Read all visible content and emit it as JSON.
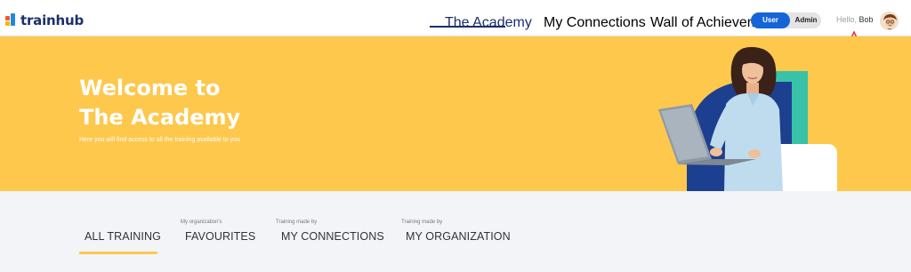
{
  "header": {
    "logo_text": "trainhub",
    "nav": [
      {
        "label": "The Academy"
      },
      {
        "label": "My Connections"
      },
      {
        "label": "Wall of Achievements"
      }
    ],
    "toggle": {
      "user_label": "User",
      "admin_label": "Admin"
    },
    "greeting": "Hello,",
    "user_name": "Bob"
  },
  "hero": {
    "title_line1": "Welcome to",
    "title_line2": "The Academy",
    "subtitle": "Here you will find access to all the training available to you"
  },
  "tabs": [
    {
      "pre": "",
      "label": "ALL TRAINING"
    },
    {
      "pre": "My organization's",
      "label": "FAVOURITES"
    },
    {
      "pre": "Training made by",
      "label": "MY CONNECTIONS"
    },
    {
      "pre": "Training made by",
      "label": "MY ORGANIZATION"
    }
  ],
  "colors": {
    "brand_navy": "#1b2f6b",
    "hero_yellow": "#fec84d",
    "toggle_blue": "#1565d8"
  }
}
